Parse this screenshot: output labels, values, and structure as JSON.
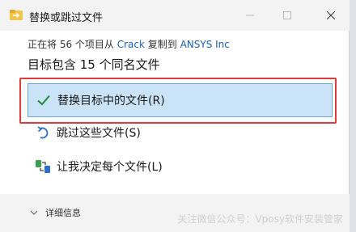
{
  "window": {
    "title": "替换或跳过文件",
    "icon_name": "file-move-icon",
    "controls": {
      "minimize": "minimize-icon",
      "maximize": "maximize-icon",
      "close": "close-icon"
    }
  },
  "transfer": {
    "prefix": "正在将 56 个项目从 ",
    "source": "Crack",
    "middle": " 复制到 ",
    "destination": "ANSYS Inc"
  },
  "heading": "目标包含 15 个同名文件",
  "options": [
    {
      "label": "替换目标中的文件(R)",
      "icon": "checkmark-icon",
      "selected": true
    },
    {
      "label": "跳过这些文件(S)",
      "icon": "skip-arrow-icon",
      "selected": false
    },
    {
      "label": "让我决定每个文件(L)",
      "icon": "decide-icon",
      "selected": false
    }
  ],
  "footer": {
    "details_label": "详细信息",
    "watermark": "关注微信公众号：Vposy软件安装管家"
  },
  "colors": {
    "accent_link": "#1a5fb4",
    "selection_bg": "#cbe3f7",
    "highlight_border": "#e03a3a",
    "check_green": "#1f8a3a"
  }
}
